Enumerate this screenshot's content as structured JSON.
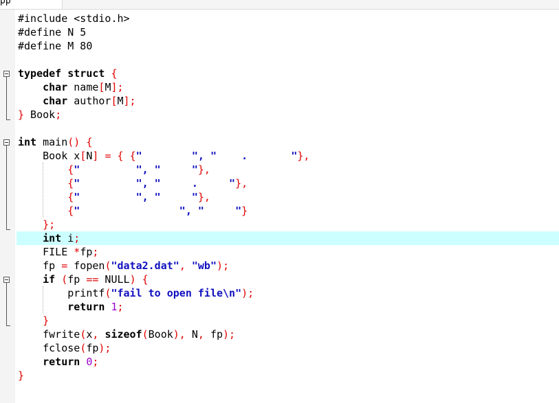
{
  "tab": {
    "label": "pp"
  },
  "code_lines": [
    [
      {
        "t": "#include <stdio.h>",
        "c": "pp"
      }
    ],
    [
      {
        "t": "#define N 5",
        "c": "pp"
      }
    ],
    [
      {
        "t": "#define M 80",
        "c": "pp"
      }
    ],
    [],
    [
      {
        "t": "typedef struct",
        "c": "kw"
      },
      {
        "t": " ",
        "c": "tx"
      },
      {
        "t": "{",
        "c": "op"
      }
    ],
    [
      {
        "t": "    ",
        "c": "tx"
      },
      {
        "t": "char",
        "c": "kw"
      },
      {
        "t": " name",
        "c": "tx"
      },
      {
        "t": "[",
        "c": "op"
      },
      {
        "t": "M",
        "c": "tx"
      },
      {
        "t": "];",
        "c": "op"
      }
    ],
    [
      {
        "t": "    ",
        "c": "tx"
      },
      {
        "t": "char",
        "c": "kw"
      },
      {
        "t": " author",
        "c": "tx"
      },
      {
        "t": "[",
        "c": "op"
      },
      {
        "t": "M",
        "c": "tx"
      },
      {
        "t": "];",
        "c": "op"
      }
    ],
    [
      {
        "t": "}",
        "c": "op"
      },
      {
        "t": " Book",
        "c": "tx"
      },
      {
        "t": ";",
        "c": "op"
      }
    ],
    [],
    [
      {
        "t": "int",
        "c": "kw"
      },
      {
        "t": " main",
        "c": "tx"
      },
      {
        "t": "()",
        "c": "op"
      },
      {
        "t": " ",
        "c": "tx"
      },
      {
        "t": "{",
        "c": "op"
      }
    ],
    [
      {
        "t": "    Book x",
        "c": "tx"
      },
      {
        "t": "[",
        "c": "op"
      },
      {
        "t": "N",
        "c": "tx"
      },
      {
        "t": "]",
        "c": "op"
      },
      {
        "t": " ",
        "c": "tx"
      },
      {
        "t": "=",
        "c": "op"
      },
      {
        "t": " ",
        "c": "tx"
      },
      {
        "t": "{",
        "c": "op"
      },
      {
        "t": " ",
        "c": "tx"
      },
      {
        "t": "{",
        "c": "op"
      },
      {
        "t": "\"        \", \"    .       \"",
        "c": "st"
      },
      {
        "t": "},",
        "c": "op"
      }
    ],
    [
      {
        "t": "        ",
        "c": "tx"
      },
      {
        "t": "{",
        "c": "op"
      },
      {
        "t": "\"         \", \"     \"",
        "c": "st"
      },
      {
        "t": "},",
        "c": "op"
      }
    ],
    [
      {
        "t": "        ",
        "c": "tx"
      },
      {
        "t": "{",
        "c": "op"
      },
      {
        "t": "\"         \", \"     .     \"",
        "c": "st"
      },
      {
        "t": "},",
        "c": "op"
      }
    ],
    [
      {
        "t": "        ",
        "c": "tx"
      },
      {
        "t": "{",
        "c": "op"
      },
      {
        "t": "\"         \", \"     \"",
        "c": "st"
      },
      {
        "t": "},",
        "c": "op"
      }
    ],
    [
      {
        "t": "        ",
        "c": "tx"
      },
      {
        "t": "{",
        "c": "op"
      },
      {
        "t": "\"                \", \"     \"",
        "c": "st"
      },
      {
        "t": "}",
        "c": "op"
      }
    ],
    [
      {
        "t": "    ",
        "c": "tx"
      },
      {
        "t": "};",
        "c": "op"
      }
    ],
    [
      {
        "t": "    ",
        "c": "tx"
      },
      {
        "t": "int",
        "c": "kw"
      },
      {
        "t": " i",
        "c": "tx"
      },
      {
        "t": ";",
        "c": "op"
      }
    ],
    [
      {
        "t": "    FILE ",
        "c": "tx"
      },
      {
        "t": "*",
        "c": "op"
      },
      {
        "t": "fp",
        "c": "tx"
      },
      {
        "t": ";",
        "c": "op"
      }
    ],
    [
      {
        "t": "    fp ",
        "c": "tx"
      },
      {
        "t": "=",
        "c": "op"
      },
      {
        "t": " fopen",
        "c": "tx"
      },
      {
        "t": "(",
        "c": "op"
      },
      {
        "t": "\"data2.dat\"",
        "c": "st"
      },
      {
        "t": ",",
        "c": "op"
      },
      {
        "t": " ",
        "c": "tx"
      },
      {
        "t": "\"wb\"",
        "c": "st"
      },
      {
        "t": ");",
        "c": "op"
      }
    ],
    [
      {
        "t": "    ",
        "c": "tx"
      },
      {
        "t": "if",
        "c": "kw"
      },
      {
        "t": " ",
        "c": "tx"
      },
      {
        "t": "(",
        "c": "op"
      },
      {
        "t": "fp ",
        "c": "tx"
      },
      {
        "t": "==",
        "c": "op"
      },
      {
        "t": " NULL",
        "c": "tx"
      },
      {
        "t": ")",
        "c": "op"
      },
      {
        "t": " ",
        "c": "tx"
      },
      {
        "t": "{",
        "c": "op"
      }
    ],
    [
      {
        "t": "        printf",
        "c": "tx"
      },
      {
        "t": "(",
        "c": "op"
      },
      {
        "t": "\"fail to open file\\n\"",
        "c": "st"
      },
      {
        "t": ");",
        "c": "op"
      }
    ],
    [
      {
        "t": "        ",
        "c": "tx"
      },
      {
        "t": "return",
        "c": "kw"
      },
      {
        "t": " ",
        "c": "tx"
      },
      {
        "t": "1",
        "c": "nm"
      },
      {
        "t": ";",
        "c": "op"
      }
    ],
    [
      {
        "t": "    ",
        "c": "tx"
      },
      {
        "t": "}",
        "c": "op"
      }
    ],
    [
      {
        "t": "    fwrite",
        "c": "tx"
      },
      {
        "t": "(",
        "c": "op"
      },
      {
        "t": "x",
        "c": "tx"
      },
      {
        "t": ",",
        "c": "op"
      },
      {
        "t": " ",
        "c": "tx"
      },
      {
        "t": "sizeof",
        "c": "kw"
      },
      {
        "t": "(",
        "c": "op"
      },
      {
        "t": "Book",
        "c": "tx"
      },
      {
        "t": "),",
        "c": "op"
      },
      {
        "t": " N",
        "c": "tx"
      },
      {
        "t": ",",
        "c": "op"
      },
      {
        "t": " fp",
        "c": "tx"
      },
      {
        "t": ");",
        "c": "op"
      }
    ],
    [
      {
        "t": "    fclose",
        "c": "tx"
      },
      {
        "t": "(",
        "c": "op"
      },
      {
        "t": "fp",
        "c": "tx"
      },
      {
        "t": ");",
        "c": "op"
      }
    ],
    [
      {
        "t": "    ",
        "c": "tx"
      },
      {
        "t": "return",
        "c": "kw"
      },
      {
        "t": " ",
        "c": "tx"
      },
      {
        "t": "0",
        "c": "nm"
      },
      {
        "t": ";",
        "c": "op"
      }
    ],
    [
      {
        "t": "}",
        "c": "op"
      }
    ]
  ]
}
